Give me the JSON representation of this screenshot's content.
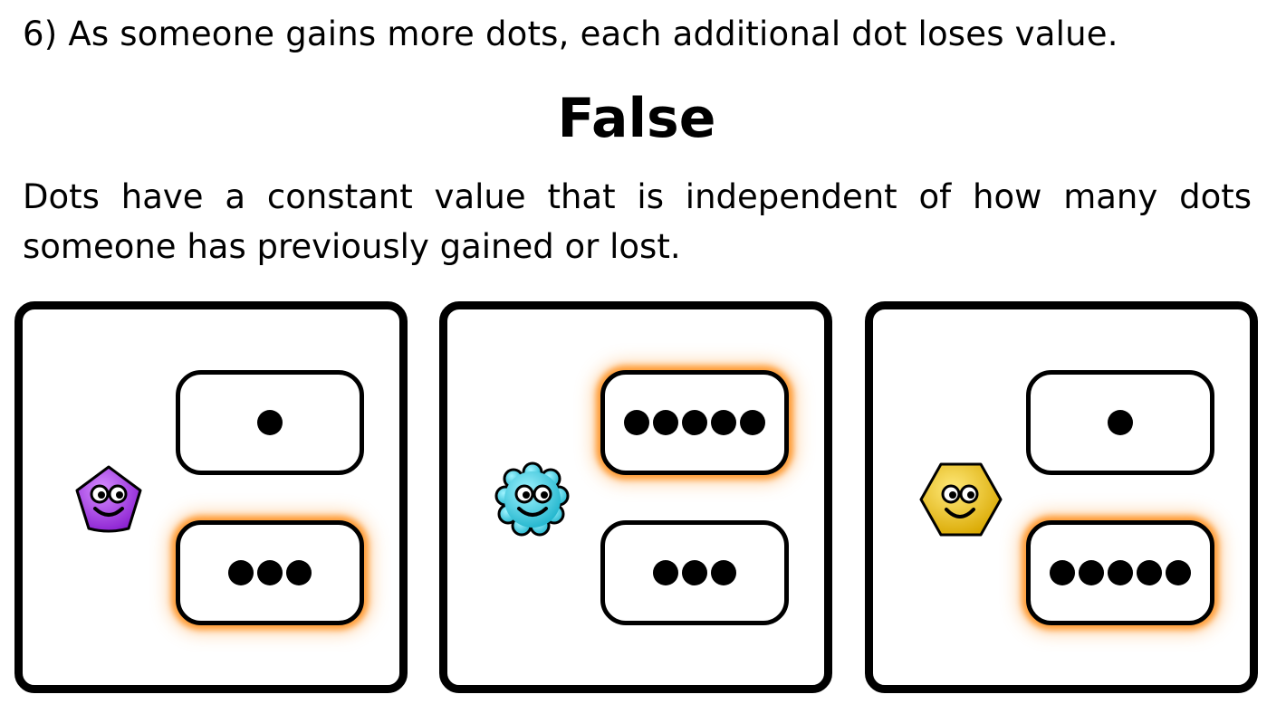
{
  "question": "6) As someone gains more dots, each additional dot loses value.",
  "answer": "False",
  "explanation": "Dots have a constant value that is independent of how many dots someone has previously gained or lost.",
  "panels": [
    {
      "avatar_icon": "purple-pentagon-smiley-icon",
      "avatar_color": "#a93de8",
      "options": [
        {
          "dots": 1,
          "chosen": false
        },
        {
          "dots": 3,
          "chosen": true
        }
      ]
    },
    {
      "avatar_icon": "cyan-flower-smiley-icon",
      "avatar_color": "#3fd2e6",
      "options": [
        {
          "dots": 5,
          "chosen": true
        },
        {
          "dots": 3,
          "chosen": false
        }
      ]
    },
    {
      "avatar_icon": "yellow-hexagon-smiley-icon",
      "avatar_color": "#f2cd1d",
      "options": [
        {
          "dots": 1,
          "chosen": false
        },
        {
          "dots": 5,
          "chosen": true
        }
      ]
    }
  ],
  "colors": {
    "highlight_glow": "#ff912e",
    "outline": "#000000"
  }
}
